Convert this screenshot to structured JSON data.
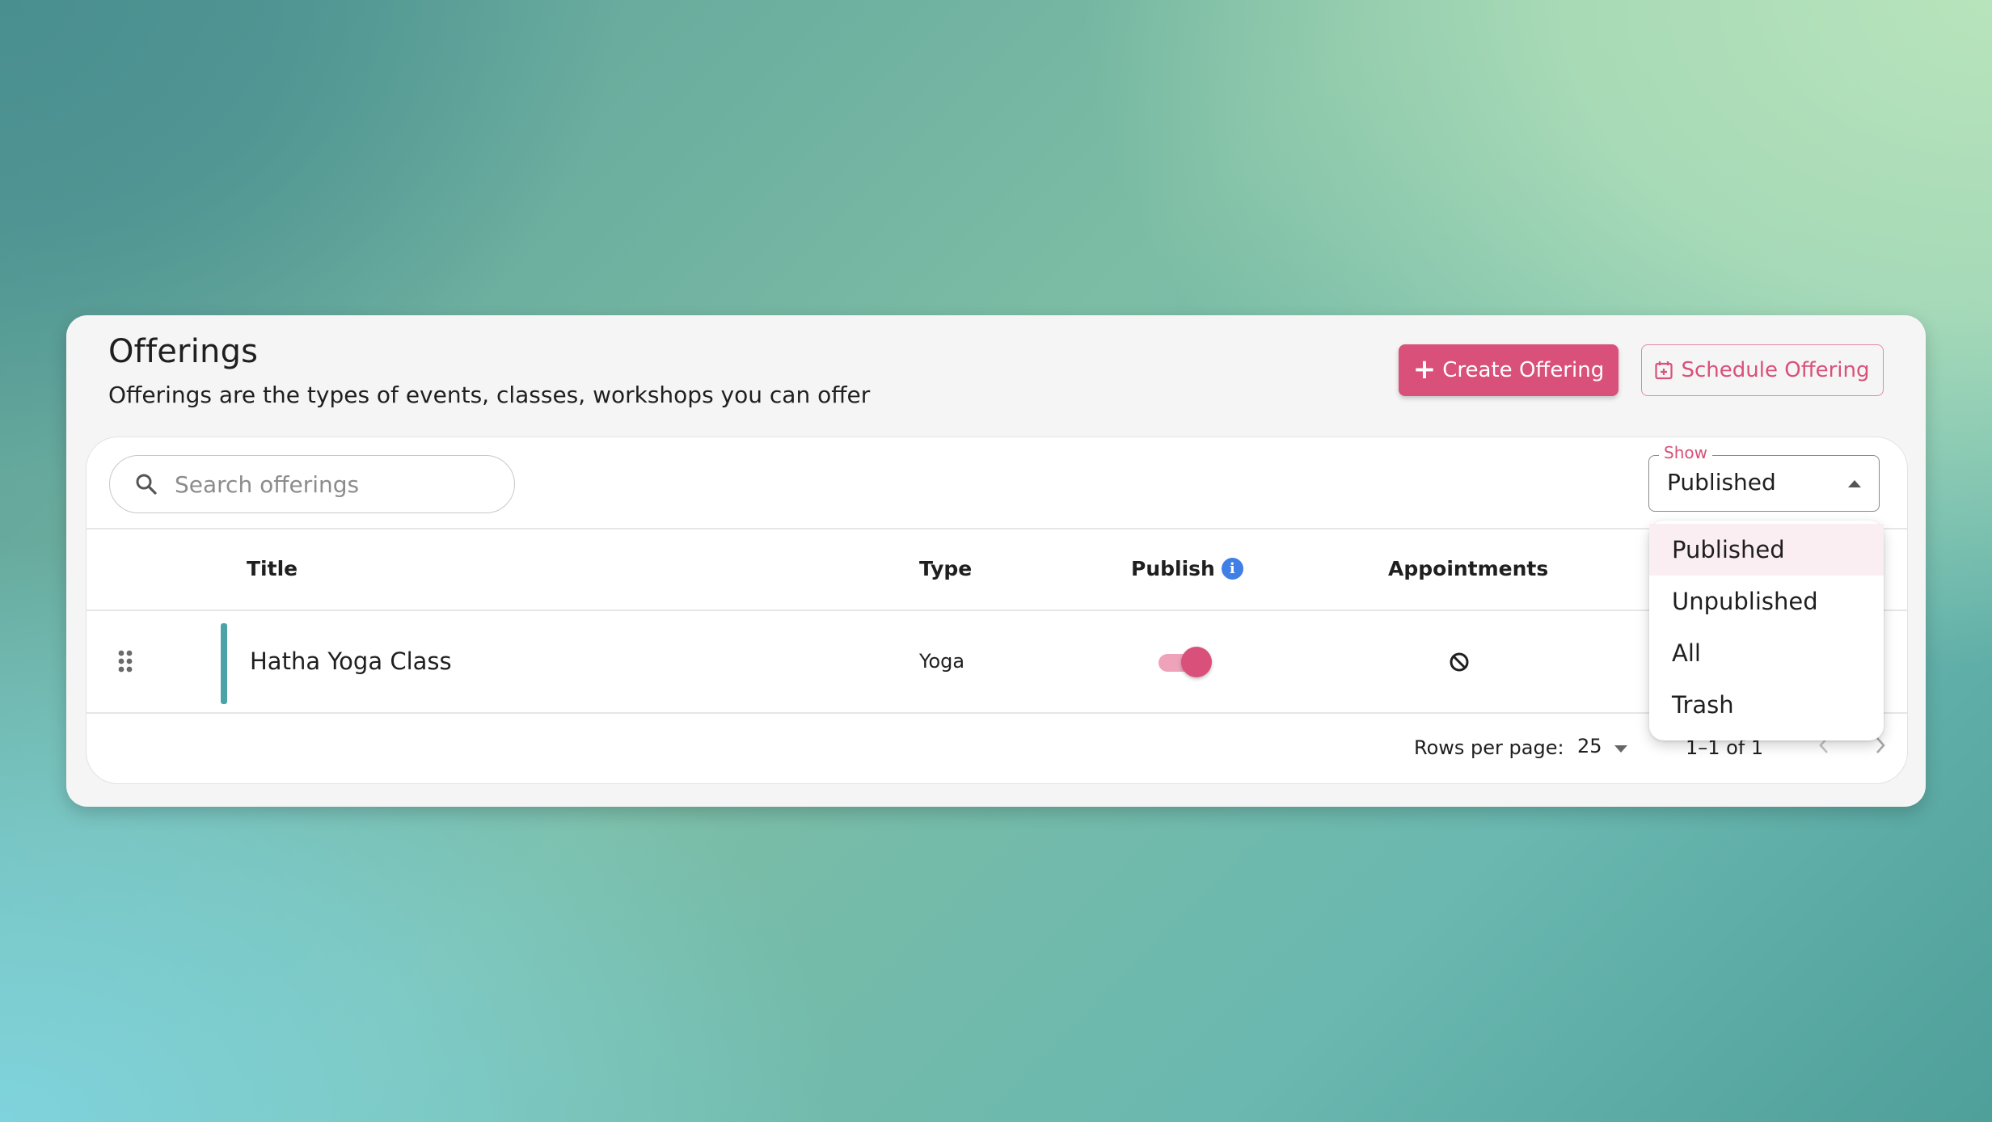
{
  "header": {
    "title": "Offerings",
    "subtitle": "Offerings are the types of events, classes, workshops you can offer",
    "create_button": "Create Offering",
    "schedule_button": "Schedule Offering"
  },
  "search": {
    "placeholder": "Search offerings",
    "value": ""
  },
  "filter": {
    "label": "Show",
    "value": "Published",
    "options": [
      "Published",
      "Unpublished",
      "All",
      "Trash"
    ],
    "selected_index": 0
  },
  "table": {
    "columns": [
      "Title",
      "Type",
      "Publish",
      "Appointments"
    ],
    "rows": [
      {
        "title": "Hatha Yoga Class",
        "type": "Yoga",
        "published": true,
        "appointments": "disabled-icon",
        "color": "#4ba3a8"
      }
    ]
  },
  "pagination": {
    "rows_per_page_label": "Rows per page:",
    "rows_per_page": "25",
    "range": "1–1 of 1"
  },
  "colors": {
    "accent": "#d9507a",
    "info": "#3f7fe6",
    "row_marker": "#4ba3a8"
  },
  "icons": {
    "create": "plus-icon",
    "schedule": "calendar-plus-icon",
    "search": "search-icon",
    "info": "info-icon",
    "drag": "drag-handle-icon",
    "appointments": "block-icon",
    "prev": "chevron-left-icon",
    "next": "chevron-right-icon"
  }
}
